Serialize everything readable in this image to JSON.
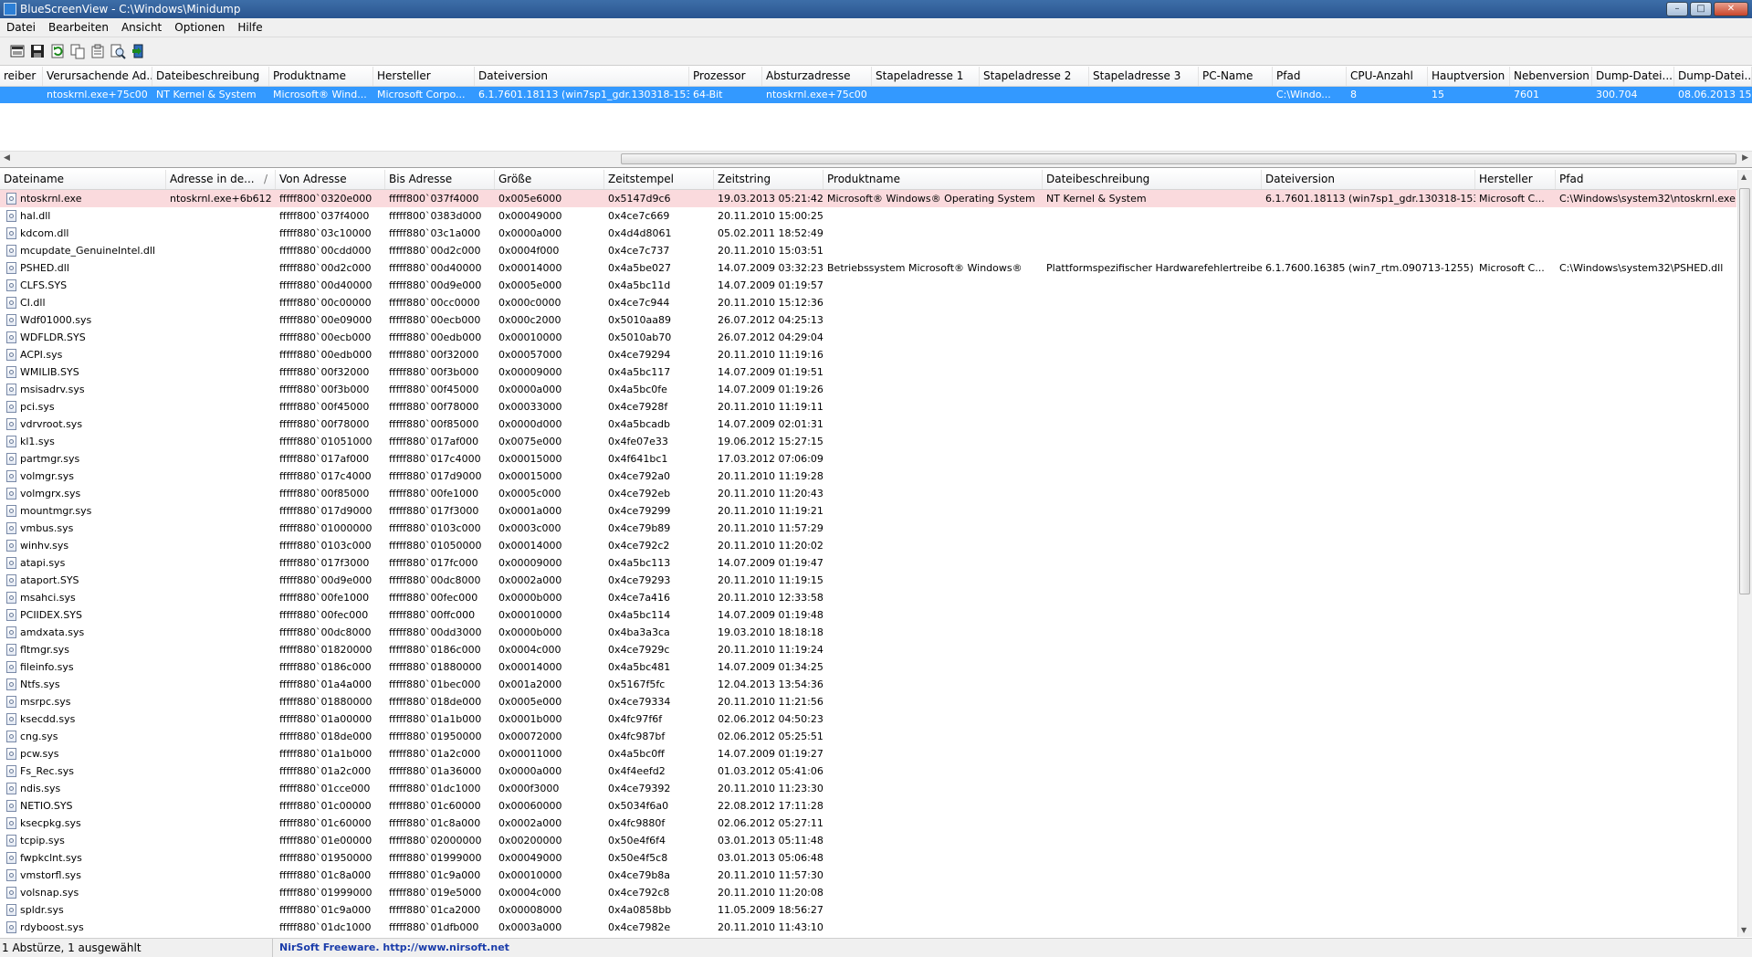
{
  "window": {
    "title": "BlueScreenView  -  C:\\Windows\\Minidump",
    "min": "0",
    "max": "1",
    "close": "r"
  },
  "menu": [
    "Datei",
    "Bearbeiten",
    "Ansicht",
    "Optionen",
    "Hilfe"
  ],
  "toolbar": [
    "save-icon",
    "save-selected-icon",
    "refresh-icon",
    "copy-icon",
    "properties-icon",
    "find-icon",
    "exit-icon"
  ],
  "top_table": {
    "columns": [
      "reiber",
      "Verursachende Ad...",
      "Dateibeschreibung",
      "Produktname",
      "Hersteller",
      "Dateiversion",
      "Prozessor",
      "Absturzadresse",
      "Stapeladresse 1",
      "Stapeladresse 2",
      "Stapeladresse 3",
      "PC-Name",
      "Pfad",
      "CPU-Anzahl",
      "Hauptversion",
      "Nebenversion",
      "Dump-Datei...",
      "Dump-Datei..."
    ],
    "selected_row": [
      "",
      "ntoskrnl.exe+75c00",
      "NT Kernel & System",
      "Microsoft® Wind...",
      "Microsoft Corpo...",
      "6.1.7601.18113 (win7sp1_gdr.130318-1533)",
      "64-Bit",
      "ntoskrnl.exe+75c00",
      "",
      "",
      "",
      "",
      "C:\\Windo...",
      "8",
      "15",
      "7601",
      "300.704",
      "08.06.2013 15..."
    ]
  },
  "lower_table": {
    "columns": [
      "Dateiname",
      "Adresse in de...",
      "Von Adresse",
      "Bis Adresse",
      "Größe",
      "Zeitstempel",
      "Zeitstring",
      "Produktname",
      "Dateibeschreibung",
      "Dateiversion",
      "Hersteller",
      "Pfad"
    ],
    "sort_indicator": "/",
    "rows": [
      [
        "ntoskrnl.exe",
        "ntoskrnl.exe+6b612",
        "fffff800`0320e000",
        "fffff800`037f4000",
        "0x005e6000",
        "0x5147d9c6",
        "19.03.2013 05:21:42",
        "Microsoft® Windows® Operating System",
        "NT Kernel & System",
        "6.1.7601.18113 (win7sp1_gdr.130318-1533)",
        "Microsoft C...",
        "C:\\Windows\\system32\\ntoskrnl.exe"
      ],
      [
        "hal.dll",
        "",
        "fffff800`037f4000",
        "fffff800`0383d000",
        "0x00049000",
        "0x4ce7c669",
        "20.11.2010 15:00:25",
        "",
        "",
        "",
        "",
        ""
      ],
      [
        "kdcom.dll",
        "",
        "fffff880`03c10000",
        "fffff880`03c1a000",
        "0x0000a000",
        "0x4d4d8061",
        "05.02.2011 18:52:49",
        "",
        "",
        "",
        "",
        ""
      ],
      [
        "mcupdate_GenuineIntel.dll",
        "",
        "fffff880`00cdd000",
        "fffff880`00d2c000",
        "0x0004f000",
        "0x4ce7c737",
        "20.11.2010 15:03:51",
        "",
        "",
        "",
        "",
        ""
      ],
      [
        "PSHED.dll",
        "",
        "fffff880`00d2c000",
        "fffff880`00d40000",
        "0x00014000",
        "0x4a5be027",
        "14.07.2009 03:32:23",
        "Betriebssystem Microsoft® Windows®",
        "Plattformspezifischer Hardwarefehlertreiber",
        "6.1.7600.16385 (win7_rtm.090713-1255)",
        "Microsoft C...",
        "C:\\Windows\\system32\\PSHED.dll"
      ],
      [
        "CLFS.SYS",
        "",
        "fffff880`00d40000",
        "fffff880`00d9e000",
        "0x0005e000",
        "0x4a5bc11d",
        "14.07.2009 01:19:57",
        "",
        "",
        "",
        "",
        ""
      ],
      [
        "CI.dll",
        "",
        "fffff880`00c00000",
        "fffff880`00cc0000",
        "0x000c0000",
        "0x4ce7c944",
        "20.11.2010 15:12:36",
        "",
        "",
        "",
        "",
        ""
      ],
      [
        "Wdf01000.sys",
        "",
        "fffff880`00e09000",
        "fffff880`00ecb000",
        "0x000c2000",
        "0x5010aa89",
        "26.07.2012 04:25:13",
        "",
        "",
        "",
        "",
        ""
      ],
      [
        "WDFLDR.SYS",
        "",
        "fffff880`00ecb000",
        "fffff880`00edb000",
        "0x00010000",
        "0x5010ab70",
        "26.07.2012 04:29:04",
        "",
        "",
        "",
        "",
        ""
      ],
      [
        "ACPI.sys",
        "",
        "fffff880`00edb000",
        "fffff880`00f32000",
        "0x00057000",
        "0x4ce79294",
        "20.11.2010 11:19:16",
        "",
        "",
        "",
        "",
        ""
      ],
      [
        "WMILIB.SYS",
        "",
        "fffff880`00f32000",
        "fffff880`00f3b000",
        "0x00009000",
        "0x4a5bc117",
        "14.07.2009 01:19:51",
        "",
        "",
        "",
        "",
        ""
      ],
      [
        "msisadrv.sys",
        "",
        "fffff880`00f3b000",
        "fffff880`00f45000",
        "0x0000a000",
        "0x4a5bc0fe",
        "14.07.2009 01:19:26",
        "",
        "",
        "",
        "",
        ""
      ],
      [
        "pci.sys",
        "",
        "fffff880`00f45000",
        "fffff880`00f78000",
        "0x00033000",
        "0x4ce7928f",
        "20.11.2010 11:19:11",
        "",
        "",
        "",
        "",
        ""
      ],
      [
        "vdrvroot.sys",
        "",
        "fffff880`00f78000",
        "fffff880`00f85000",
        "0x0000d000",
        "0x4a5bcadb",
        "14.07.2009 02:01:31",
        "",
        "",
        "",
        "",
        ""
      ],
      [
        "kl1.sys",
        "",
        "fffff880`01051000",
        "fffff880`017af000",
        "0x0075e000",
        "0x4fe07e33",
        "19.06.2012 15:27:15",
        "",
        "",
        "",
        "",
        ""
      ],
      [
        "partmgr.sys",
        "",
        "fffff880`017af000",
        "fffff880`017c4000",
        "0x00015000",
        "0x4f641bc1",
        "17.03.2012 07:06:09",
        "",
        "",
        "",
        "",
        ""
      ],
      [
        "volmgr.sys",
        "",
        "fffff880`017c4000",
        "fffff880`017d9000",
        "0x00015000",
        "0x4ce792a0",
        "20.11.2010 11:19:28",
        "",
        "",
        "",
        "",
        ""
      ],
      [
        "volmgrx.sys",
        "",
        "fffff880`00f85000",
        "fffff880`00fe1000",
        "0x0005c000",
        "0x4ce792eb",
        "20.11.2010 11:20:43",
        "",
        "",
        "",
        "",
        ""
      ],
      [
        "mountmgr.sys",
        "",
        "fffff880`017d9000",
        "fffff880`017f3000",
        "0x0001a000",
        "0x4ce79299",
        "20.11.2010 11:19:21",
        "",
        "",
        "",
        "",
        ""
      ],
      [
        "vmbus.sys",
        "",
        "fffff880`01000000",
        "fffff880`0103c000",
        "0x0003c000",
        "0x4ce79b89",
        "20.11.2010 11:57:29",
        "",
        "",
        "",
        "",
        ""
      ],
      [
        "winhv.sys",
        "",
        "fffff880`0103c000",
        "fffff880`01050000",
        "0x00014000",
        "0x4ce792c2",
        "20.11.2010 11:20:02",
        "",
        "",
        "",
        "",
        ""
      ],
      [
        "atapi.sys",
        "",
        "fffff880`017f3000",
        "fffff880`017fc000",
        "0x00009000",
        "0x4a5bc113",
        "14.07.2009 01:19:47",
        "",
        "",
        "",
        "",
        ""
      ],
      [
        "ataport.SYS",
        "",
        "fffff880`00d9e000",
        "fffff880`00dc8000",
        "0x0002a000",
        "0x4ce79293",
        "20.11.2010 11:19:15",
        "",
        "",
        "",
        "",
        ""
      ],
      [
        "msahci.sys",
        "",
        "fffff880`00fe1000",
        "fffff880`00fec000",
        "0x0000b000",
        "0x4ce7a416",
        "20.11.2010 12:33:58",
        "",
        "",
        "",
        "",
        ""
      ],
      [
        "PCIIDEX.SYS",
        "",
        "fffff880`00fec000",
        "fffff880`00ffc000",
        "0x00010000",
        "0x4a5bc114",
        "14.07.2009 01:19:48",
        "",
        "",
        "",
        "",
        ""
      ],
      [
        "amdxata.sys",
        "",
        "fffff880`00dc8000",
        "fffff880`00dd3000",
        "0x0000b000",
        "0x4ba3a3ca",
        "19.03.2010 18:18:18",
        "",
        "",
        "",
        "",
        ""
      ],
      [
        "fltmgr.sys",
        "",
        "fffff880`01820000",
        "fffff880`0186c000",
        "0x0004c000",
        "0x4ce7929c",
        "20.11.2010 11:19:24",
        "",
        "",
        "",
        "",
        ""
      ],
      [
        "fileinfo.sys",
        "",
        "fffff880`0186c000",
        "fffff880`01880000",
        "0x00014000",
        "0x4a5bc481",
        "14.07.2009 01:34:25",
        "",
        "",
        "",
        "",
        ""
      ],
      [
        "Ntfs.sys",
        "",
        "fffff880`01a4a000",
        "fffff880`01bec000",
        "0x001a2000",
        "0x5167f5fc",
        "12.04.2013 13:54:36",
        "",
        "",
        "",
        "",
        ""
      ],
      [
        "msrpc.sys",
        "",
        "fffff880`01880000",
        "fffff880`018de000",
        "0x0005e000",
        "0x4ce79334",
        "20.11.2010 11:21:56",
        "",
        "",
        "",
        "",
        ""
      ],
      [
        "ksecdd.sys",
        "",
        "fffff880`01a00000",
        "fffff880`01a1b000",
        "0x0001b000",
        "0x4fc97f6f",
        "02.06.2012 04:50:23",
        "",
        "",
        "",
        "",
        ""
      ],
      [
        "cng.sys",
        "",
        "fffff880`018de000",
        "fffff880`01950000",
        "0x00072000",
        "0x4fc987bf",
        "02.06.2012 05:25:51",
        "",
        "",
        "",
        "",
        ""
      ],
      [
        "pcw.sys",
        "",
        "fffff880`01a1b000",
        "fffff880`01a2c000",
        "0x00011000",
        "0x4a5bc0ff",
        "14.07.2009 01:19:27",
        "",
        "",
        "",
        "",
        ""
      ],
      [
        "Fs_Rec.sys",
        "",
        "fffff880`01a2c000",
        "fffff880`01a36000",
        "0x0000a000",
        "0x4f4eefd2",
        "01.03.2012 05:41:06",
        "",
        "",
        "",
        "",
        ""
      ],
      [
        "ndis.sys",
        "",
        "fffff880`01cce000",
        "fffff880`01dc1000",
        "0x000f3000",
        "0x4ce79392",
        "20.11.2010 11:23:30",
        "",
        "",
        "",
        "",
        ""
      ],
      [
        "NETIO.SYS",
        "",
        "fffff880`01c00000",
        "fffff880`01c60000",
        "0x00060000",
        "0x5034f6a0",
        "22.08.2012 17:11:28",
        "",
        "",
        "",
        "",
        ""
      ],
      [
        "ksecpkg.sys",
        "",
        "fffff880`01c60000",
        "fffff880`01c8a000",
        "0x0002a000",
        "0x4fc9880f",
        "02.06.2012 05:27:11",
        "",
        "",
        "",
        "",
        ""
      ],
      [
        "tcpip.sys",
        "",
        "fffff880`01e00000",
        "fffff880`02000000",
        "0x00200000",
        "0x50e4f6f4",
        "03.01.2013 05:11:48",
        "",
        "",
        "",
        "",
        ""
      ],
      [
        "fwpkclnt.sys",
        "",
        "fffff880`01950000",
        "fffff880`01999000",
        "0x00049000",
        "0x50e4f5c8",
        "03.01.2013 05:06:48",
        "",
        "",
        "",
        "",
        ""
      ],
      [
        "vmstorfl.sys",
        "",
        "fffff880`01c8a000",
        "fffff880`01c9a000",
        "0x00010000",
        "0x4ce79b8a",
        "20.11.2010 11:57:30",
        "",
        "",
        "",
        "",
        ""
      ],
      [
        "volsnap.sys",
        "",
        "fffff880`01999000",
        "fffff880`019e5000",
        "0x0004c000",
        "0x4ce792c8",
        "20.11.2010 11:20:08",
        "",
        "",
        "",
        "",
        ""
      ],
      [
        "spldr.sys",
        "",
        "fffff880`01c9a000",
        "fffff880`01ca2000",
        "0x00008000",
        "0x4a0858bb",
        "11.05.2009 18:56:27",
        "",
        "",
        "",
        "",
        ""
      ],
      [
        "rdyboost.sys",
        "",
        "fffff880`01dc1000",
        "fffff880`01dfb000",
        "0x0003a000",
        "0x4ce7982e",
        "20.11.2010 11:43:10",
        "",
        "",
        "",
        "",
        ""
      ]
    ]
  },
  "statusbar": {
    "count": "1 Abstürze, 1 ausgewählt",
    "freeware": "NirSoft Freeware.  http://www.nirsoft.net"
  }
}
